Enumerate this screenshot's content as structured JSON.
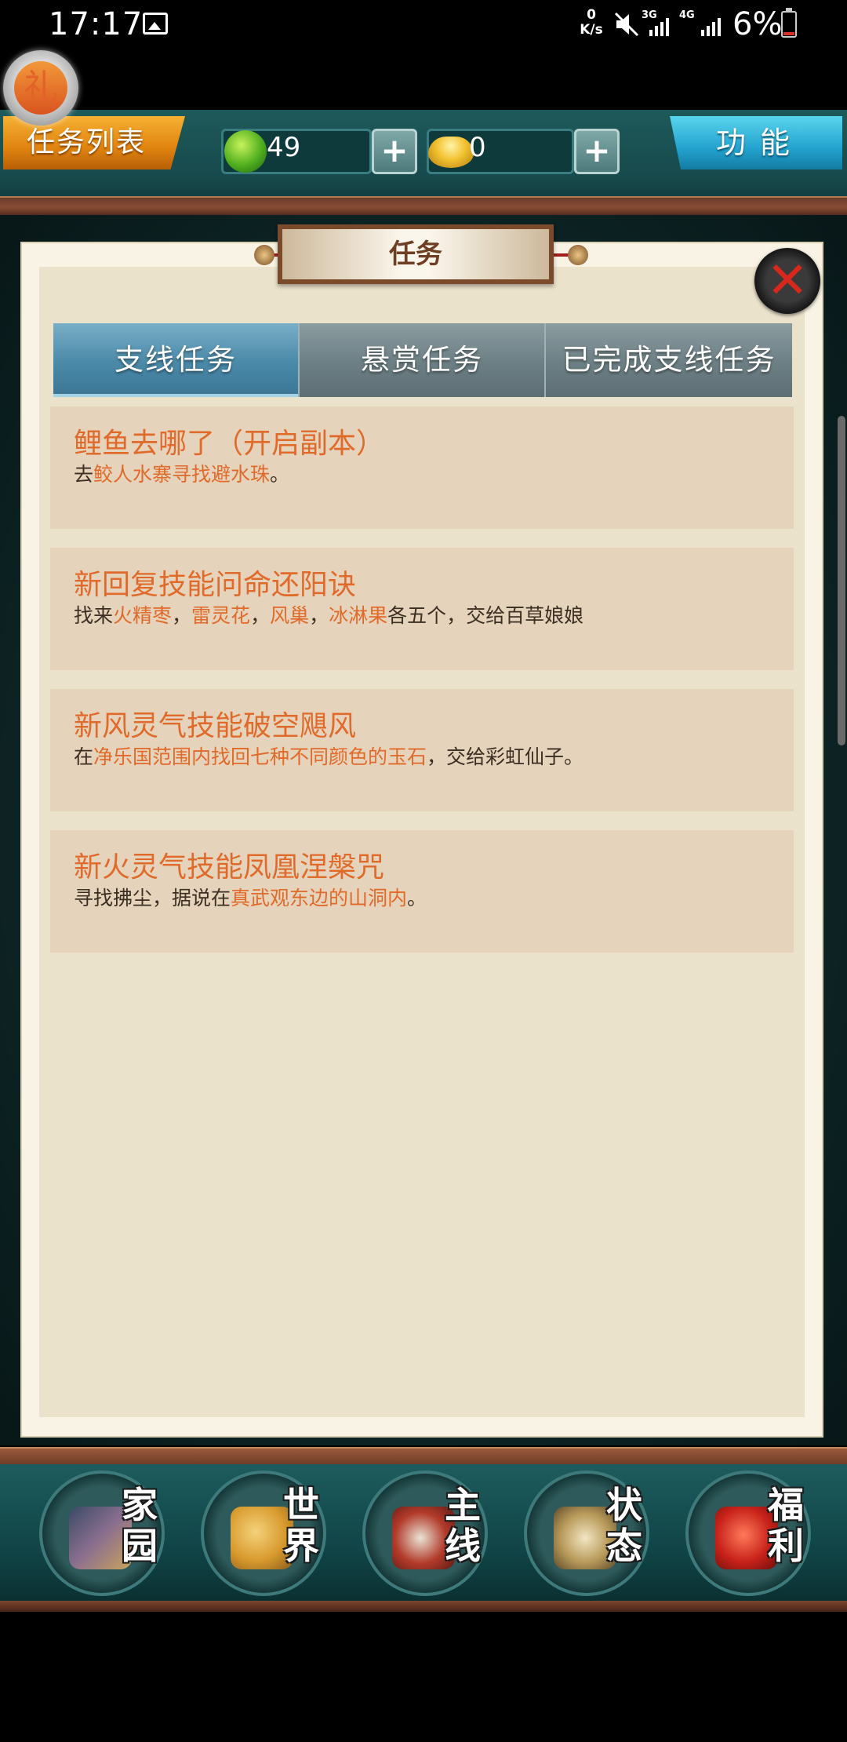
{
  "status_bar": {
    "time": "17:17",
    "speed_value": "0",
    "speed_unit": "K/s",
    "net1": "3G",
    "net2": "4G",
    "battery": "6%"
  },
  "gift": {
    "label": "礼"
  },
  "top_bar": {
    "task_list_label": "任务列表",
    "jade_value": "49",
    "gold_value": "0",
    "plus_label": "+",
    "function_label": "功能"
  },
  "panel": {
    "title": "任务",
    "close_label": "✕",
    "tabs": [
      {
        "label": "支线任务"
      },
      {
        "label": "悬赏任务"
      },
      {
        "label": "已完成支线任务"
      }
    ],
    "quests": [
      {
        "title": "鲤鱼去哪了（开启副本）",
        "desc": [
          {
            "t": "去",
            "hl": false
          },
          {
            "t": "鲛人水寨寻找避水珠",
            "hl": true
          },
          {
            "t": "。",
            "hl": false
          }
        ]
      },
      {
        "title": "新回复技能问命还阳诀",
        "desc": [
          {
            "t": "找来",
            "hl": false
          },
          {
            "t": "火精枣",
            "hl": true
          },
          {
            "t": "，",
            "hl": false
          },
          {
            "t": "雷灵花",
            "hl": true
          },
          {
            "t": "，",
            "hl": false
          },
          {
            "t": "风巢",
            "hl": true
          },
          {
            "t": "，",
            "hl": false
          },
          {
            "t": "冰淋果",
            "hl": true
          },
          {
            "t": "各五个，交给百草娘娘",
            "hl": false
          }
        ]
      },
      {
        "title": "新风灵气技能破空飓风",
        "desc": [
          {
            "t": "在",
            "hl": false
          },
          {
            "t": "净乐国范围内找回七种不同颜色的玉石",
            "hl": true
          },
          {
            "t": "，交给彩虹仙子。",
            "hl": false
          }
        ]
      },
      {
        "title": "新火灵气技能凤凰涅槃咒",
        "desc": [
          {
            "t": "寻找拂尘，据说在",
            "hl": false
          },
          {
            "t": "真武观东边的山洞内",
            "hl": true
          },
          {
            "t": "。",
            "hl": false
          }
        ]
      }
    ]
  },
  "bottom_nav": [
    {
      "label": "家园",
      "icon": "home-icon"
    },
    {
      "label": "世界",
      "icon": "world-map-icon"
    },
    {
      "label": "主线",
      "icon": "main-quest-icon"
    },
    {
      "label": "状态",
      "icon": "status-bagua-icon"
    },
    {
      "label": "福利",
      "icon": "welfare-bag-icon"
    }
  ],
  "colors": {
    "highlight": "#e06a2a",
    "orange_button": "#f0a029",
    "blue_button": "#2fb4dc",
    "teal_frame": "#1a5557"
  }
}
